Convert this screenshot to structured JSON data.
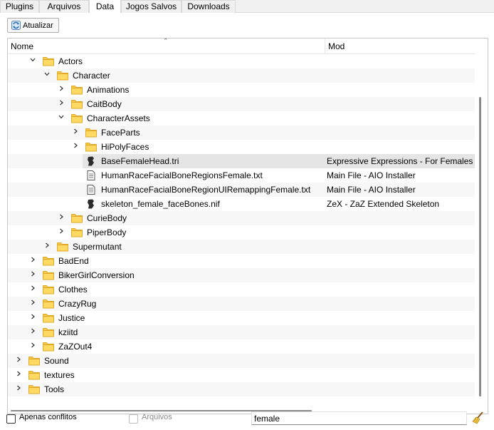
{
  "tabs": [
    {
      "label": "Plugins"
    },
    {
      "label": "Arquivos"
    },
    {
      "label": "Data"
    },
    {
      "label": "Jogos Salvos"
    },
    {
      "label": "Downloads"
    }
  ],
  "active_tab": "Data",
  "toolbar": {
    "refresh_label": "Atualizar",
    "refresh_icon": "refresh-icon"
  },
  "tree": {
    "columns": [
      {
        "label": "Nome"
      },
      {
        "label": "Mod"
      }
    ],
    "rows": [
      {
        "name": "Actors",
        "mod": "",
        "type": "folder",
        "expanded": true
      },
      {
        "name": "Character",
        "mod": "",
        "type": "folder",
        "expanded": true
      },
      {
        "name": "Animations",
        "mod": "",
        "type": "folder",
        "expanded": false
      },
      {
        "name": "CaitBody",
        "mod": "",
        "type": "folder",
        "expanded": false
      },
      {
        "name": "CharacterAssets",
        "mod": "",
        "type": "folder",
        "expanded": true
      },
      {
        "name": "FaceParts",
        "mod": "",
        "type": "folder",
        "expanded": false
      },
      {
        "name": "HiPolyFaces",
        "mod": "",
        "type": "folder",
        "expanded": false
      },
      {
        "name": "BaseFemaleHead.tri",
        "mod": "Expressive Expressions - For Females",
        "type": "tri-file",
        "selected": true
      },
      {
        "name": "HumanRaceFacialBoneRegionsFemale.txt",
        "mod": "Main File - AIO Installer",
        "type": "text-file"
      },
      {
        "name": "HumanRaceFacialBoneRegionUIRemappingFemale.txt",
        "mod": "Main File - AIO Installer",
        "type": "text-file"
      },
      {
        "name": "skeleton_female_faceBones.nif",
        "mod": "ZeX - ZaZ Extended Skeleton",
        "type": "nif-file"
      },
      {
        "name": "CurieBody",
        "mod": "",
        "type": "folder",
        "expanded": false
      },
      {
        "name": "PiperBody",
        "mod": "",
        "type": "folder",
        "expanded": false
      },
      {
        "name": "Supermutant",
        "mod": "",
        "type": "folder",
        "expanded": false
      },
      {
        "name": "BadEnd",
        "mod": "",
        "type": "folder",
        "expanded": false
      },
      {
        "name": "BikerGirlConversion",
        "mod": "",
        "type": "folder",
        "expanded": false
      },
      {
        "name": "Clothes",
        "mod": "",
        "type": "folder",
        "expanded": false
      },
      {
        "name": "CrazyRug",
        "mod": "",
        "type": "folder",
        "expanded": false
      },
      {
        "name": "Justice",
        "mod": "",
        "type": "folder",
        "expanded": false
      },
      {
        "name": "kziitd",
        "mod": "",
        "type": "folder",
        "expanded": false
      },
      {
        "name": "ZaZOut4",
        "mod": "",
        "type": "folder",
        "expanded": false
      },
      {
        "name": "Sound",
        "mod": "",
        "type": "folder",
        "expanded": false
      },
      {
        "name": "textures",
        "mod": "",
        "type": "folder",
        "expanded": false
      },
      {
        "name": "Tools",
        "mod": "",
        "type": "folder",
        "expanded": false
      }
    ]
  },
  "footer": {
    "only_conflicts_label": "Apenas conflitos",
    "only_conflicts_checked": false,
    "archives_label": "Arquivos",
    "archives_checked": false,
    "archives_enabled": false,
    "filter_value": "female",
    "clear_icon": "broom-icon"
  },
  "colors": {
    "folder": "#f6c94a",
    "folder_dark": "#e0a92a",
    "selected_row": "#e5e5e5"
  }
}
